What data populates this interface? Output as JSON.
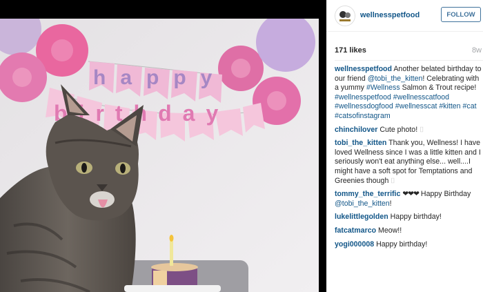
{
  "post": {
    "username": "wellnesspetfood",
    "follow_label": "FOLLOW",
    "likes": "171 likes",
    "age": "8w"
  },
  "banner": {
    "line1": "happy",
    "line2": "birthday"
  },
  "caption": {
    "username": "wellnesspetfood",
    "t1": "Another belated birthday to our friend",
    "mention": "@tobi_the_kitten",
    "t2": "! Celebrating with a yummy",
    "tag1": "#Wellness",
    "t3": "Salmon & Trout recipe!",
    "tags": "#wellnesspetfood #wellnesscatfood #wellnessdogfood #wellnesscat #kitten #cat #catsofinstagram"
  },
  "comments": [
    {
      "user": "chinchilover",
      "text": "Cute photo!",
      "flag": "⌷"
    },
    {
      "user": "tobi_the_kitten",
      "text": "Thank you, Wellness! I have loved Wellness since I was a little kitten and I seriously won't eat anything else... well....I might have a soft spot for Temptations and Greenies though",
      "flag": "⌷"
    },
    {
      "user": "tommy_the_terrific",
      "hearts": "❤❤❤",
      "text": "Happy Birthday",
      "mention": "@tobi_the_kitten",
      "text2": "!"
    },
    {
      "user": "lukelittlegolden",
      "text": "Happy birthday!"
    },
    {
      "user": "fatcatmarco",
      "text": "Meow!!"
    },
    {
      "user": "yogi000008",
      "text": "Happy birthday!"
    }
  ]
}
